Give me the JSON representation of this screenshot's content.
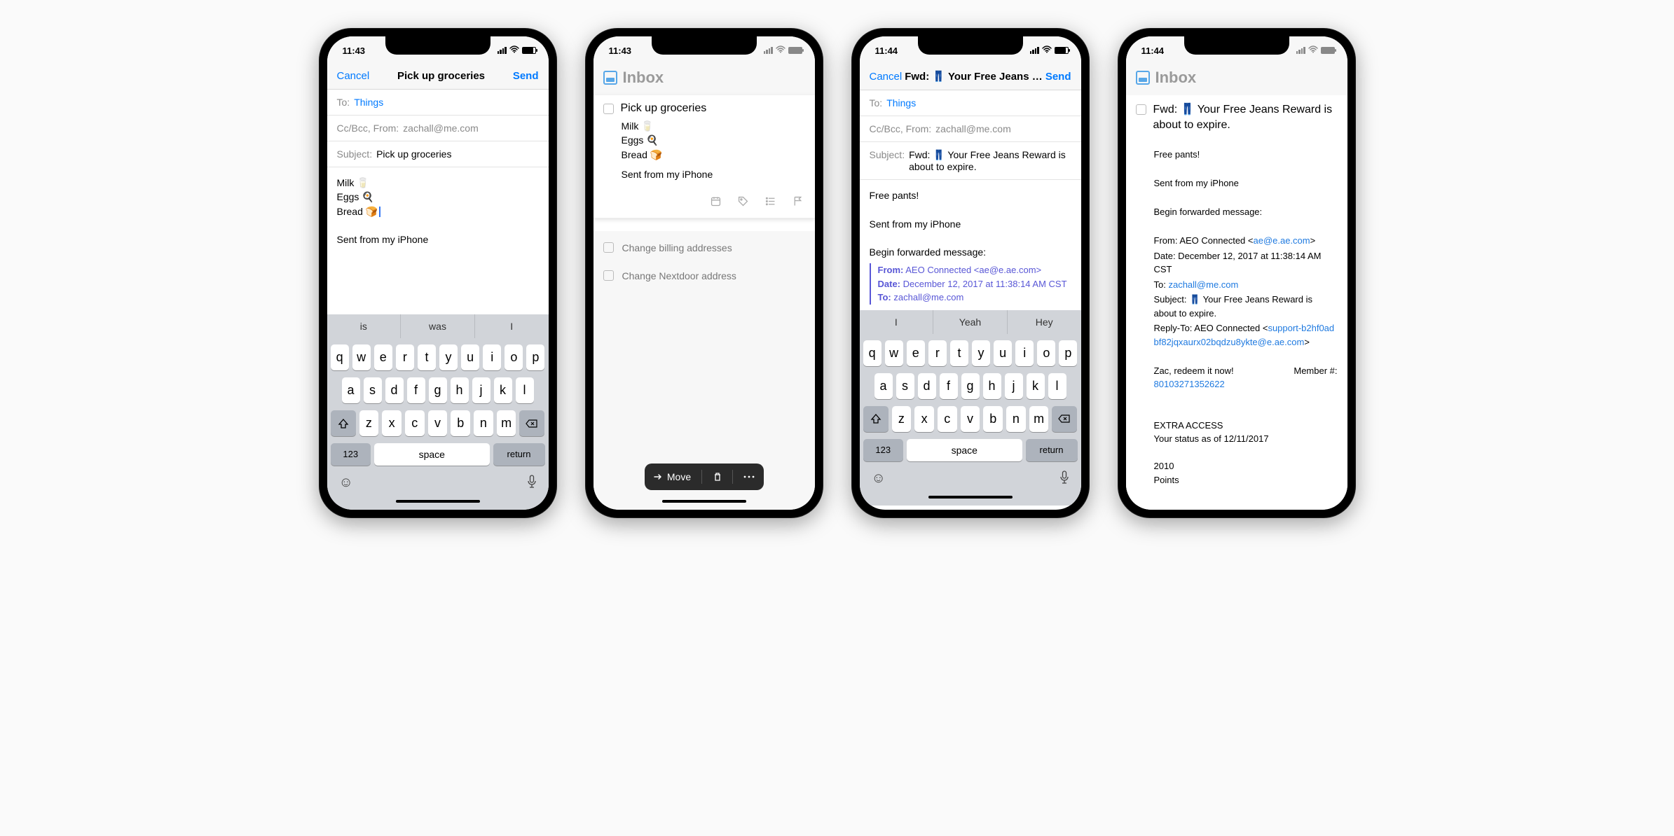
{
  "status": {
    "time1": "11:43",
    "time2": "11:43",
    "time3": "11:44",
    "time4": "11:44"
  },
  "phone1": {
    "cancel": "Cancel",
    "title": "Pick up groceries",
    "send": "Send",
    "to_label": "To:",
    "to_value": "Things",
    "ccbcc": "Cc/Bcc, From:",
    "from_email": "zachall@me.com",
    "subject_label": "Subject:",
    "subject_value": "Pick up groceries",
    "body_line1": "Milk 🥛",
    "body_line2": "Eggs 🍳",
    "body_line3": "Bread 🍞",
    "signature": "Sent from my iPhone",
    "sugg": [
      "is",
      "was",
      "I"
    ],
    "row1": [
      "q",
      "w",
      "e",
      "r",
      "t",
      "y",
      "u",
      "i",
      "o",
      "p"
    ],
    "row2": [
      "a",
      "s",
      "d",
      "f",
      "g",
      "h",
      "j",
      "k",
      "l"
    ],
    "row3": [
      "z",
      "x",
      "c",
      "v",
      "b",
      "n",
      "m"
    ],
    "k123": "123",
    "kspace": "space",
    "kreturn": "return"
  },
  "phone2": {
    "header": "Inbox",
    "task_title": "Pick up groceries",
    "note1": "Milk 🥛",
    "note2": "Eggs 🍳",
    "note3": "Bread 🍞",
    "signature": "Sent from my iPhone",
    "later1": "Change billing addresses",
    "later2": "Change Nextdoor address",
    "move": "Move"
  },
  "phone3": {
    "cancel": "Cancel",
    "title_prefix": "Fwd: ",
    "title_rest": "Your Free Jeans R…",
    "send": "Send",
    "to_label": "To:",
    "to_value": "Things",
    "ccbcc": "Cc/Bcc, From:",
    "from_email": "zachall@me.com",
    "subject_label": "Subject:",
    "subject_value_prefix": "Fwd: ",
    "subject_value_rest": "Your Free Jeans Reward is about to expire.",
    "body1": "Free pants!",
    "sig": "Sent from my iPhone",
    "begin_fwd": "Begin forwarded message:",
    "fwd_from_k": "From:",
    "fwd_from_v": "AEO Connected <ae@e.ae.com>",
    "fwd_date_k": "Date:",
    "fwd_date_v": "December 12, 2017 at 11:38:14 AM CST",
    "fwd_to_k": "To:",
    "fwd_to_v": "zachall@me.com",
    "sugg": [
      "I",
      "Yeah",
      "Hey"
    ],
    "row1": [
      "q",
      "w",
      "e",
      "r",
      "t",
      "y",
      "u",
      "i",
      "o",
      "p"
    ],
    "row2": [
      "a",
      "s",
      "d",
      "f",
      "g",
      "h",
      "j",
      "k",
      "l"
    ],
    "row3": [
      "z",
      "x",
      "c",
      "v",
      "b",
      "n",
      "m"
    ],
    "k123": "123",
    "kspace": "space",
    "kreturn": "return"
  },
  "phone4": {
    "header": "Inbox",
    "title_prefix": "Fwd: ",
    "title_rest": "Your Free Jeans Reward is about to expire.",
    "l_free": "Free pants!",
    "l_sig": "Sent from my iPhone",
    "l_begin": "Begin forwarded message:",
    "from_lbl": "From: AEO Connected <",
    "from_link": "ae@e.ae.com",
    "from_end": ">",
    "date": "Date: December 12, 2017 at 11:38:14 AM CST",
    "to_lbl": "To: ",
    "to_link": "zachall@me.com",
    "subj_lbl": "Subject: ",
    "subj_rest": "Your Free Jeans Reward is about to expire.",
    "reply_lbl": "Reply-To: AEO Connected <",
    "reply_link": "support-b2hf0adbf82jqxaurx02bqdzu8ykte@e.ae.com",
    "reply_end": ">",
    "redeem": "Zac, redeem it now!",
    "member_lbl": "Member #:",
    "member_num": "80103271352622",
    "extra": "EXTRA ACCESS",
    "status_as": "Your status as of 12/11/2017",
    "points_n": "2010",
    "points_w": "Points"
  }
}
